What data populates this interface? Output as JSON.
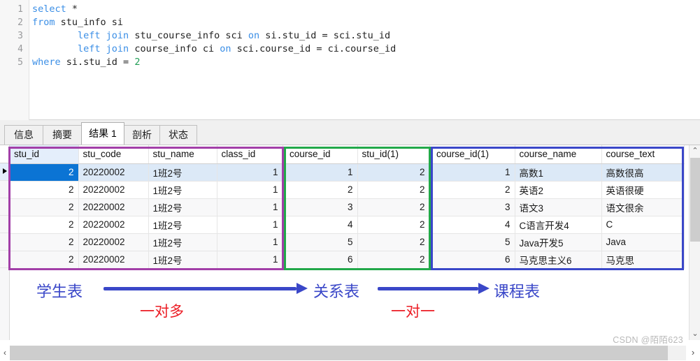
{
  "editor": {
    "line_numbers": [
      "1",
      "2",
      "3",
      "4",
      "5"
    ],
    "lines": [
      [
        {
          "t": "select",
          "c": "kw"
        },
        {
          "t": " *",
          "c": ""
        }
      ],
      [
        {
          "t": "from",
          "c": "kw"
        },
        {
          "t": " stu_info si",
          "c": ""
        }
      ],
      [
        {
          "t": "        ",
          "c": ""
        },
        {
          "t": "left join",
          "c": "kw"
        },
        {
          "t": " stu_course_info sci ",
          "c": ""
        },
        {
          "t": "on",
          "c": "kw"
        },
        {
          "t": " si.stu_id = sci.stu_id",
          "c": ""
        }
      ],
      [
        {
          "t": "        ",
          "c": ""
        },
        {
          "t": "left join",
          "c": "kw"
        },
        {
          "t": " course_info ci ",
          "c": ""
        },
        {
          "t": "on",
          "c": "kw"
        },
        {
          "t": " sci.course_id = ci.course_id",
          "c": ""
        }
      ],
      [
        {
          "t": "where",
          "c": "kw"
        },
        {
          "t": " si.stu_id = ",
          "c": ""
        },
        {
          "t": "2",
          "c": "num"
        }
      ]
    ],
    "plain_text": "select *\nfrom stu_info si\n        left join stu_course_info sci on si.stu_id = sci.stu_id\n        left join course_info ci on sci.course_id = ci.course_id\nwhere si.stu_id = 2"
  },
  "tabs": [
    {
      "label": "信息",
      "active": false
    },
    {
      "label": "摘要",
      "active": false
    },
    {
      "label": "结果 1",
      "active": true
    },
    {
      "label": "剖析",
      "active": false
    },
    {
      "label": "状态",
      "active": false
    }
  ],
  "grid": {
    "student_table": {
      "columns": [
        "stu_id",
        "stu_code",
        "stu_name",
        "class_id"
      ],
      "selected_column": "stu_id",
      "rows": [
        [
          "2",
          "20220002",
          "1班2号",
          "1"
        ],
        [
          "2",
          "20220002",
          "1班2号",
          "1"
        ],
        [
          "2",
          "20220002",
          "1班2号",
          "1"
        ],
        [
          "2",
          "20220002",
          "1班2号",
          "1"
        ],
        [
          "2",
          "20220002",
          "1班2号",
          "1"
        ],
        [
          "2",
          "20220002",
          "1班2号",
          "1"
        ]
      ]
    },
    "relation_table": {
      "columns": [
        "course_id",
        "stu_id(1)"
      ],
      "rows": [
        [
          "1",
          "2"
        ],
        [
          "2",
          "2"
        ],
        [
          "3",
          "2"
        ],
        [
          "4",
          "2"
        ],
        [
          "5",
          "2"
        ],
        [
          "6",
          "2"
        ]
      ]
    },
    "course_table": {
      "columns": [
        "course_id(1)",
        "course_name",
        "course_text"
      ],
      "rows": [
        [
          "1",
          "高数1",
          "高数很高"
        ],
        [
          "2",
          "英语2",
          "英语很硬"
        ],
        [
          "3",
          "语文3",
          "语文很余"
        ],
        [
          "4",
          "C语言开发4",
          "C"
        ],
        [
          "5",
          "Java开发5",
          "Java"
        ],
        [
          "6",
          "马克思主义6",
          "马克思"
        ]
      ]
    }
  },
  "annotations": {
    "labels": [
      {
        "text": "学生表"
      },
      {
        "text": "关系表"
      },
      {
        "text": "课程表"
      }
    ],
    "relations": [
      {
        "text": "一对多"
      },
      {
        "text": "一对一"
      }
    ]
  },
  "highlight_boxes": {
    "student_color": "#a23fa8",
    "relation_color": "#22a84a",
    "course_color": "#3a47c8"
  },
  "scrollbars": {
    "v_up_icon": "⌃",
    "v_down_icon": "⌄",
    "h_left_icon": "‹",
    "h_right_icon": "›"
  },
  "watermark": {
    "text": "CSDN @陌陌623"
  }
}
